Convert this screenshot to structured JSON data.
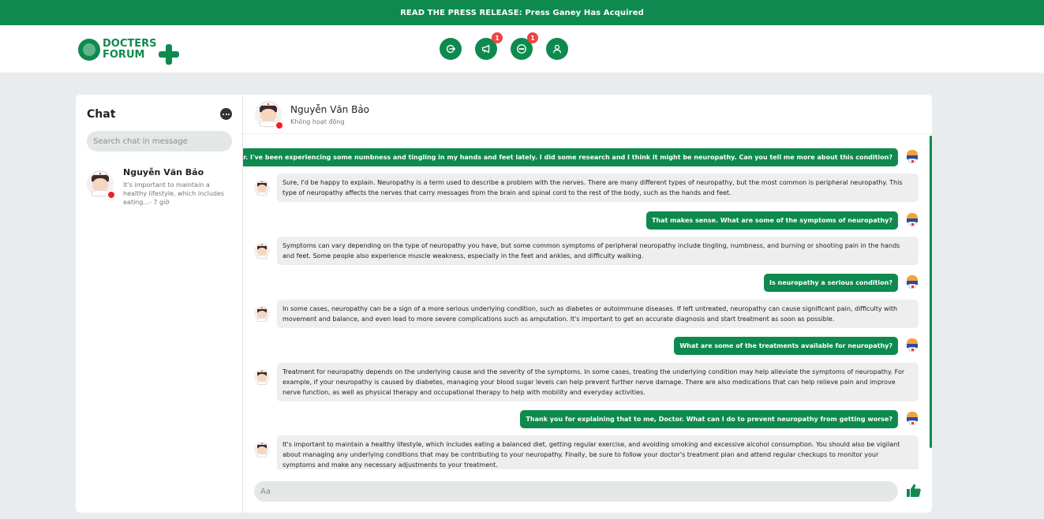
{
  "banner": {
    "text": "READ THE PRESS RELEASE: Press Ganey Has Acquired"
  },
  "logo": {
    "line1": "DOCTERS",
    "line2": "FORUM"
  },
  "nav": [
    {
      "name": "logout-icon",
      "badge": ""
    },
    {
      "name": "megaphone-icon",
      "badge": "1"
    },
    {
      "name": "message-icon",
      "badge": "1"
    },
    {
      "name": "user-icon",
      "badge": ""
    }
  ],
  "sidebar": {
    "title": "Chat",
    "search_placeholder": "Search chat in message",
    "contacts": [
      {
        "name": "Nguyễn Văn Bảo",
        "preview": "It's important to maintain a healthy lifestyle, which includes eating...- 7 giờ"
      }
    ]
  },
  "chat": {
    "contact_name": "Nguyễn Văn Bảo",
    "contact_status": "Không hoạt động",
    "messages": [
      {
        "dir": "out",
        "text": "Hello, Doctor. I've been experiencing some numbness and tingling in my hands and feet lately. I did some research and I think it might be neuropathy. Can you tell me more about this condition?"
      },
      {
        "dir": "in",
        "text": "Sure, I'd be happy to explain. Neuropathy is a term used to describe a problem with the nerves. There are many different types of neuropathy, but the most common is peripheral neuropathy. This type of neuropathy affects the nerves that carry messages from the brain and spinal cord to the rest of the body, such as the hands and feet."
      },
      {
        "dir": "out",
        "text": "That makes sense. What are some of the symptoms of neuropathy?"
      },
      {
        "dir": "in",
        "text": "Symptoms can vary depending on the type of neuropathy you have, but some common symptoms of peripheral neuropathy include tingling, numbness, and burning or shooting pain in the hands and feet. Some people also experience muscle weakness, especially in the feet and ankles, and difficulty walking."
      },
      {
        "dir": "out",
        "text": "Is neuropathy a serious condition?"
      },
      {
        "dir": "in",
        "text": "In some cases, neuropathy can be a sign of a more serious underlying condition, such as diabetes or autoimmune diseases. If left untreated, neuropathy can cause significant pain, difficulty with movement and balance, and even lead to more severe complications such as amputation. It's important to get an accurate diagnosis and start treatment as soon as possible."
      },
      {
        "dir": "out",
        "text": "What are some of the treatments available for neuropathy?"
      },
      {
        "dir": "in",
        "text": "Treatment for neuropathy depends on the underlying cause and the severity of the symptoms. In some cases, treating the underlying condition may help alleviate the symptoms of neuropathy. For example, if your neuropathy is caused by diabetes, managing your blood sugar levels can help prevent further nerve damage. There are also medications that can help relieve pain and improve nerve function, as well as physical therapy and occupational therapy to help with mobility and everyday activities."
      },
      {
        "dir": "out",
        "text": "Thank you for explaining that to me, Doctor. What can I do to prevent neuropathy from getting worse?"
      },
      {
        "dir": "in",
        "text": "It's important to maintain a healthy lifestyle, which includes eating a balanced diet, getting regular exercise, and avoiding smoking and excessive alcohol consumption. You should also be vigilant about managing any underlying conditions that may be contributing to your neuropathy. Finally, be sure to follow your doctor's treatment plan and attend regular checkups to monitor your symptoms and make any necessary adjustments to your treatment."
      }
    ],
    "composer_placeholder": "Aa"
  },
  "colors": {
    "brand": "#0f8a4f",
    "badge": "#ee4444",
    "status_offline": "#e22222"
  }
}
